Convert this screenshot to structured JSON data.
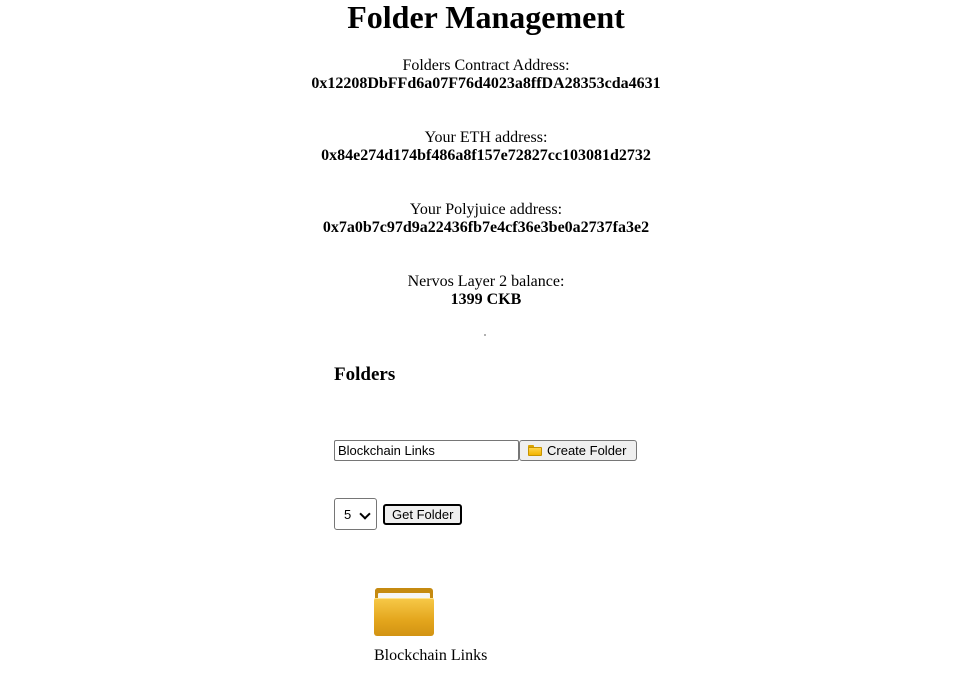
{
  "page": {
    "title": "Folder Management"
  },
  "info": {
    "contract": {
      "label": "Folders Contract Address:",
      "value": "0x12208DbFFd6a07F76d4023a8ffDA28353cda4631"
    },
    "eth": {
      "label": "Your ETH address:",
      "value": "0x84e274d174bf486a8f157e72827cc103081d2732"
    },
    "polyjuice": {
      "label": "Your Polyjuice address:",
      "value": "0x7a0b7c97d9a22436fb7e4cf36e3be0a2737fa3e2"
    },
    "balance": {
      "label": "Nervos Layer 2 balance:",
      "value": "1399 CKB"
    }
  },
  "folders": {
    "heading": "Folders",
    "create": {
      "input_value": "Blockchain Links",
      "button_label": "Create Folder",
      "button_icon": "folder-icon"
    },
    "get": {
      "selected_value": "5",
      "button_label": "Get Folder"
    },
    "items": [
      {
        "name": "Blockchain Links",
        "icon": "folder-icon"
      }
    ]
  }
}
